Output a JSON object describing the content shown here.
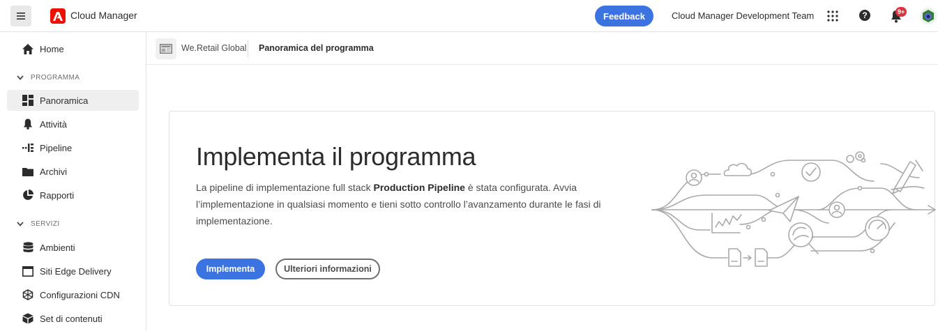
{
  "topbar": {
    "brand_name": "Cloud Manager",
    "feedback_label": "Feedback",
    "org_name": "Cloud Manager Development Team",
    "notification_badge": "9+",
    "accent_color": "#3b73e0",
    "brand_color": "#eb1000"
  },
  "sidebar": {
    "home": "Home",
    "section_programma": "PROGRAMMA",
    "panoramica": "Panoramica",
    "attivita": "Attività",
    "pipeline": "Pipeline",
    "archivi": "Archivi",
    "rapporti": "Rapporti",
    "section_servizi": "SERVIZI",
    "ambienti": "Ambienti",
    "siti_edge": "Siti Edge Delivery",
    "config_cdn": "Configurazioni CDN",
    "set_contenuti": "Set di contenuti"
  },
  "breadcrumb": {
    "program": "We.Retail Global",
    "page": "Panoramica del programma"
  },
  "card": {
    "title": "Implementa il programma",
    "desc_before": "La pipeline di implementazione full stack ",
    "desc_bold": "Production Pipeline",
    "desc_after": " è stata configurata. Avvia l’implementazione in qualsiasi momento e tieni sotto controllo l’avanzamento durante le fasi di implementazione.",
    "primary_button": "Implementa",
    "secondary_button": "Ulteriori informazioni"
  }
}
